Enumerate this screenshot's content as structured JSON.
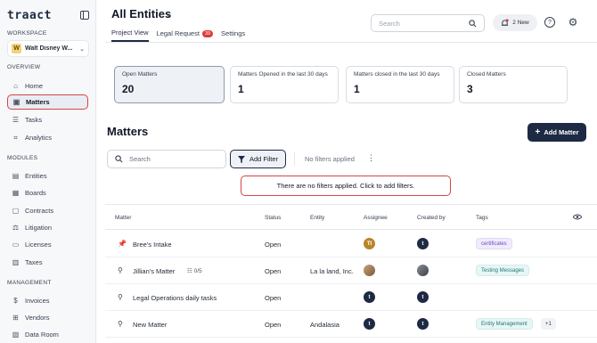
{
  "sidebar": {
    "brand": "traact",
    "workspace_label": "WORKSPACE",
    "workspace": {
      "initial": "W",
      "name": "Walt Disney W..."
    },
    "overview_label": "OVERVIEW",
    "overview_items": [
      {
        "label": "Home",
        "icon": "home-icon"
      },
      {
        "label": "Matters",
        "icon": "briefcase-icon",
        "active": true
      },
      {
        "label": "Tasks",
        "icon": "list-icon"
      },
      {
        "label": "Analytics",
        "icon": "chart-icon"
      }
    ],
    "modules_label": "MODULES",
    "module_items": [
      {
        "label": "Entities",
        "icon": "building-icon"
      },
      {
        "label": "Boards",
        "icon": "board-icon"
      },
      {
        "label": "Contracts",
        "icon": "contract-icon"
      },
      {
        "label": "Litigation",
        "icon": "gavel-icon"
      },
      {
        "label": "Licenses",
        "icon": "license-icon"
      },
      {
        "label": "Taxes",
        "icon": "tax-icon"
      }
    ],
    "management_label": "MANAGEMENT",
    "management_items": [
      {
        "label": "Invoices",
        "icon": "invoice-icon"
      },
      {
        "label": "Vendors",
        "icon": "vendor-icon"
      },
      {
        "label": "Data Room",
        "icon": "dataroom-icon"
      }
    ]
  },
  "header": {
    "title": "All Entities",
    "tabs": [
      {
        "label": "Project View",
        "active": true
      },
      {
        "label": "Legal Request",
        "badge": "39"
      },
      {
        "label": "Settings"
      }
    ],
    "search_placeholder": "Search",
    "notifications": "2 New"
  },
  "stats": [
    {
      "label": "Open Matters",
      "value": "20",
      "active": true
    },
    {
      "label": "Matters Opened in the last 30 days",
      "value": "1"
    },
    {
      "label": "Matters closed in the last 30 days",
      "value": "1"
    },
    {
      "label": "Closed Matters",
      "value": "3"
    }
  ],
  "matters": {
    "heading": "Matters",
    "add_button": "Add Matter",
    "search_placeholder": "Search",
    "add_filter": "Add Filter",
    "no_filters": "No filters applied",
    "banner": "There are no filters applied. Click to add filters."
  },
  "table": {
    "columns": [
      "Matter",
      "Status",
      "Entity",
      "Assignee",
      "Created by",
      "Tags"
    ],
    "rows": [
      {
        "matter": "Bree's Intake",
        "pinned": true,
        "subtasks": "",
        "status": "Open",
        "entity": "",
        "assignee": "TI",
        "tags": [
          "certificates"
        ]
      },
      {
        "matter": "Jillian's Matter",
        "pinned": false,
        "subtasks": "0/5",
        "status": "Open",
        "entity": "La la land, Inc.",
        "assignee": "",
        "tags": [
          "Testing Messages"
        ]
      },
      {
        "matter": "Legal Operations daily tasks",
        "pinned": false,
        "subtasks": "",
        "status": "Open",
        "entity": "",
        "assignee": "t",
        "tags": []
      },
      {
        "matter": "New Matter",
        "pinned": false,
        "subtasks": "",
        "status": "Open",
        "entity": "Andalasia",
        "assignee": "t",
        "tags": [
          "Entity Management",
          "+1"
        ]
      }
    ]
  },
  "created_by_initial": "t"
}
